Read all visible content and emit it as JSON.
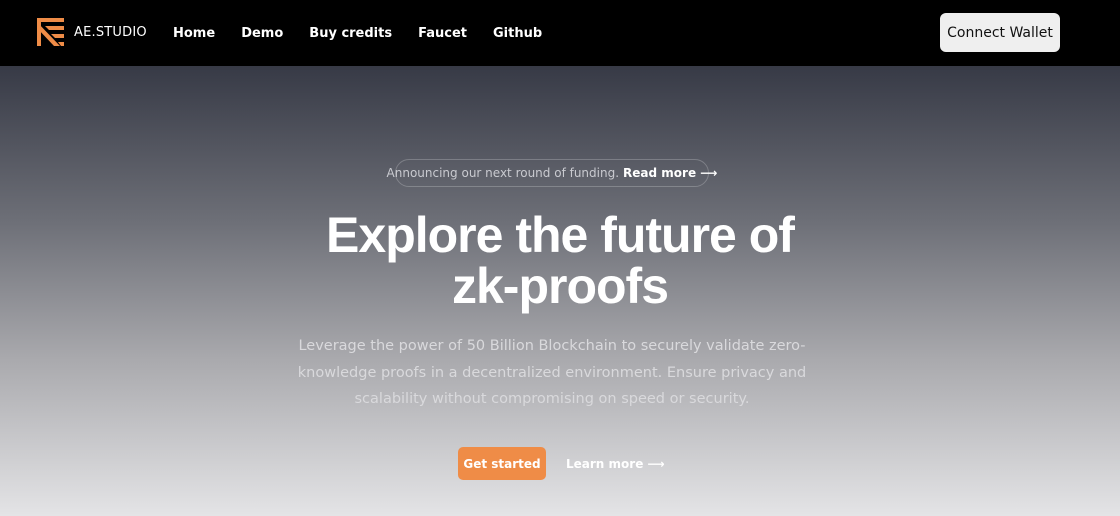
{
  "header": {
    "brand": {
      "logo_icon": "ae-studio-logo-icon",
      "name": "AE.STUDIO"
    },
    "nav": [
      {
        "label": "Home"
      },
      {
        "label": "Demo"
      },
      {
        "label": "Buy credits"
      },
      {
        "label": "Faucet"
      },
      {
        "label": "Github"
      }
    ],
    "connect_wallet_label": "Connect Wallet"
  },
  "hero": {
    "announcement": {
      "text": "Announcing our next round of funding.",
      "link_label": "Read more ⟶"
    },
    "headline_line1": "Explore the future of",
    "headline_line2": "zk-proofs",
    "subtitle": "Leverage the power of 50 Billion Blockchain to securely validate zero-knowledge proofs in a decentralized environment. Ensure privacy and scalability without compromising on speed or security.",
    "primary_cta": "Get started",
    "secondary_cta": "Learn more ⟶"
  },
  "colors": {
    "accent": "#ef8c47",
    "nav_bg": "#000000",
    "button_light": "#efefef"
  }
}
